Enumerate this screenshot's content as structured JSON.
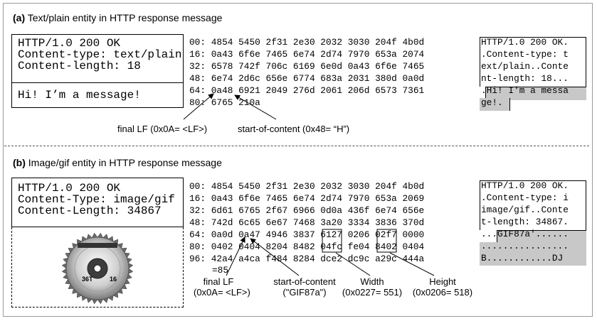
{
  "panel_a": {
    "title_prefix": "(a)",
    "title_text": "Text/plain entity in HTTP response message",
    "header_lines": [
      "HTTP/1.0 200 OK",
      "Content-type: text/plain",
      "Content-length: 18"
    ],
    "body_text": "Hi! I’m a message!",
    "hex_lines": [
      "00: 4854 5450 2f31 2e30 2032 3030 204f 4b0d",
      "16: 0a43 6f6e 7465 6e74 2d74 7970 653a 2074",
      "32: 6578 742f 706c 6169 6e0d 0a43 6f6e 7465",
      "48: 6e74 2d6c 656e 6774 683a 2031 380d 0a0d",
      "64: 0a48 6921 2049 276d 2061 206d 6573 7361",
      "80: 6765 210a"
    ],
    "ascii_lines": [
      "HTTP/1.0 200 OK.",
      ".Content-type: t",
      "ext/plain..Conte",
      "nt-length: 18...",
      ".Hi! I'm a messa",
      "ge!."
    ],
    "label_final_lf": "final LF (0x0A= <LF>)",
    "label_start": "start-of-content (0x48= “H”)"
  },
  "panel_b": {
    "title_prefix": "(b)",
    "title_text": "Image/gif entity in HTTP response message",
    "header_lines": [
      "HTTP/1.0 200 OK",
      "Content-Type: image/gif",
      "Content-Length: 34867"
    ],
    "hex_lines": [
      "00: 4854 5450 2f31 2e30 2032 3030 204f 4b0d",
      "16: 0a43 6f6e 7465 6e74 2d74 7970 653a 2069",
      "32: 6d61 6765 2f67 6966 0d0a 436f 6e74 656e",
      "48: 742d 6c65 6e67 7468 3a20 3334 3836 370d",
      "64: 0a0d 0a47 4946 3837 6127 0206 02f7 0000",
      "80: 0402 0404 8204 8482 04fc fe04 8402 0404",
      "96: 42a4 a4ca f484 8284 dce2 dc9c a29c 444a"
    ],
    "hex_tail": "=85",
    "ascii_lines": [
      "HTTP/1.0 200 OK.",
      ".Content-type: i",
      "image/gif..Conte",
      "t-length: 34867.",
      "...GIF87a'......",
      "................",
      "B............DJ"
    ],
    "label_final_lf": [
      "final LF",
      "(0x0A= <LF>)"
    ],
    "label_start": [
      "start-of-content",
      "(\"GIF87a\")"
    ],
    "label_width": [
      "Width",
      "(0x0227= 551)"
    ],
    "label_height": [
      "Height",
      "(0x0206= 518)"
    ],
    "blade_left_text": "36T",
    "blade_right_text": "16"
  }
}
